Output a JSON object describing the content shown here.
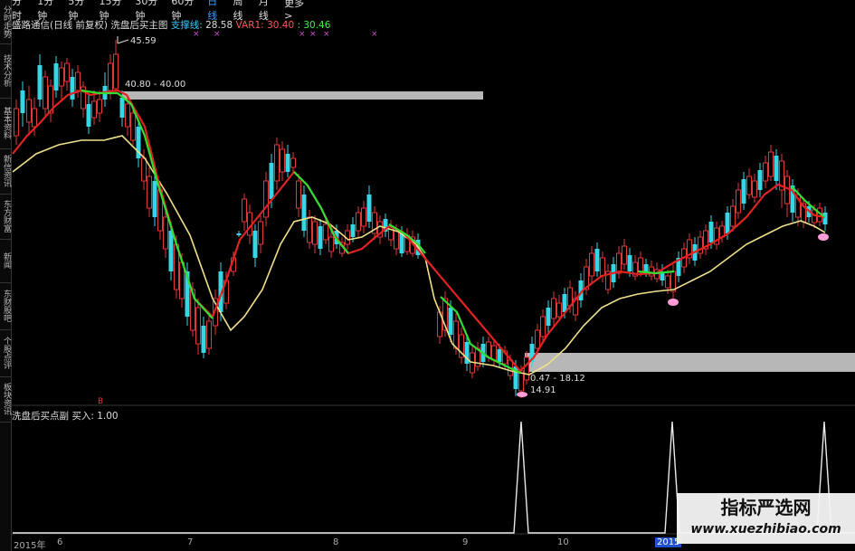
{
  "timeframes": [
    "分时",
    "1分钟",
    "5分钟",
    "15分钟",
    "30分钟",
    "60分钟",
    "日线",
    "周线",
    "月线",
    "更多 >"
  ],
  "active_timeframe": "日线",
  "sidebar_tabs": [
    "分时走势",
    "技术分析",
    "基本资料",
    "新信资讯",
    "东方财富",
    "新闻",
    "东财股吧",
    "个股点评",
    "板块资讯"
  ],
  "legend": {
    "title": "盛路通信(日线 前复权)",
    "indicator": "洗盘后买主图",
    "support_label": "支撑线:",
    "support_value": "28.58",
    "var1_label": "VAR1:",
    "var1_value": "30.40",
    "var2_value": ": 30.46"
  },
  "price_marks": {
    "high": "45.59",
    "zone_top": "40.80 - 40.00",
    "zone_bottom": "0.47 - 18.12",
    "low": "14.91"
  },
  "sub_legend": {
    "name": "洗盘后买点副",
    "buy_label": "买入:",
    "buy_value": "1.00"
  },
  "x_axis": [
    "2015年",
    "6",
    "7",
    "8",
    "9",
    "10",
    "2015"
  ],
  "watermark": {
    "cn": "指标严选网",
    "url": "www.xuezhibiao.com"
  },
  "colors": {
    "up": "#e0393a",
    "down": "#36d6e6",
    "ma_red": "#e32222",
    "ma_green": "#33dd33",
    "ma_yellow": "#f1e08a",
    "zone": "#b7b7b7",
    "signal": "#e9e9e9"
  }
}
